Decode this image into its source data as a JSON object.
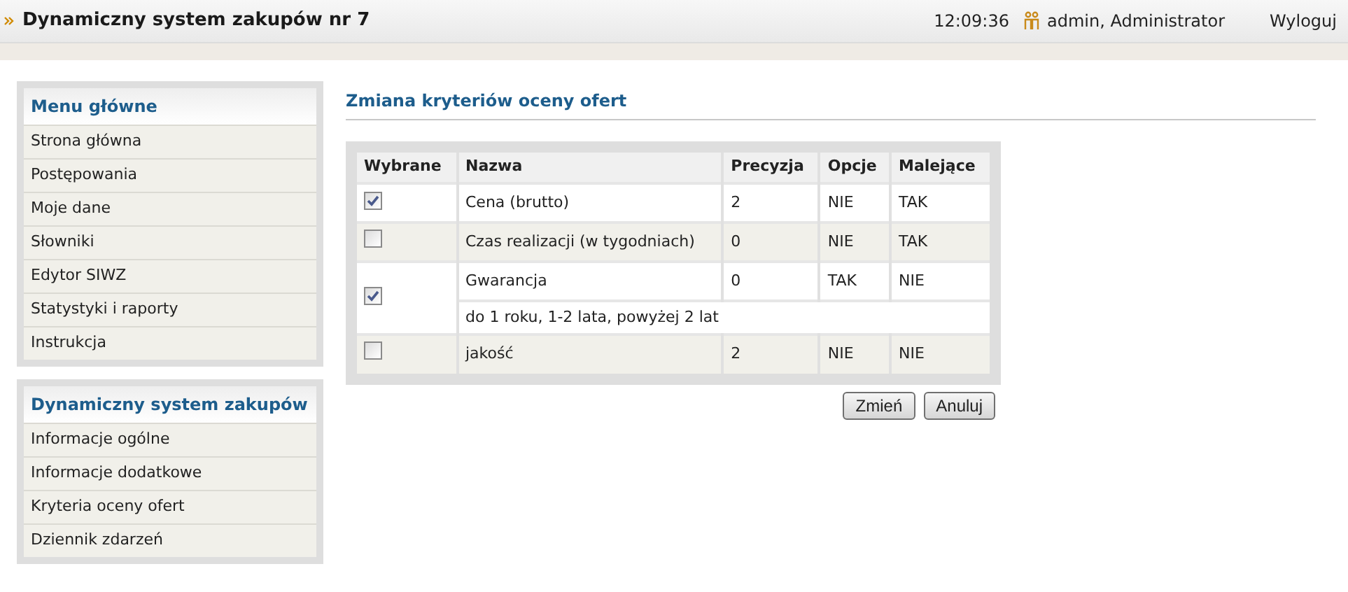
{
  "header": {
    "title": "Dynamiczny system zakupów nr 7",
    "time": "12:09:36",
    "user": "admin, Administrator",
    "logout": "Wyloguj"
  },
  "sidebar": [
    {
      "title": "Menu główne",
      "items": [
        "Strona główna",
        "Postępowania",
        "Moje dane",
        "Słowniki",
        "Edytor SIWZ",
        "Statystyki i raporty",
        "Instrukcja"
      ]
    },
    {
      "title": "Dynamiczny system zakupów",
      "items": [
        "Informacje ogólne",
        "Informacje dodatkowe",
        "Kryteria oceny ofert",
        "Dziennik zdarzeń"
      ]
    }
  ],
  "content": {
    "heading": "Zmiana kryteriów oceny ofert",
    "table": {
      "columns": [
        "Wybrane",
        "Nazwa",
        "Precyzja",
        "Opcje",
        "Malejące"
      ],
      "rows": [
        {
          "checked": true,
          "name": "Cena (brutto)",
          "precision": "2",
          "options": "NIE",
          "descending": "TAK"
        },
        {
          "checked": false,
          "name": "Czas realizacji (w tygodniach)",
          "precision": "0",
          "options": "NIE",
          "descending": "TAK"
        },
        {
          "checked": true,
          "name": "Gwarancja",
          "precision": "0",
          "options": "TAK",
          "descending": "NIE",
          "note": "do 1 roku, 1-2 lata, powyżej 2 lat"
        },
        {
          "checked": false,
          "name": "jakość",
          "precision": "2",
          "options": "NIE",
          "descending": "NIE"
        }
      ]
    },
    "buttons": [
      "Zmień",
      "Anuluj"
    ]
  }
}
